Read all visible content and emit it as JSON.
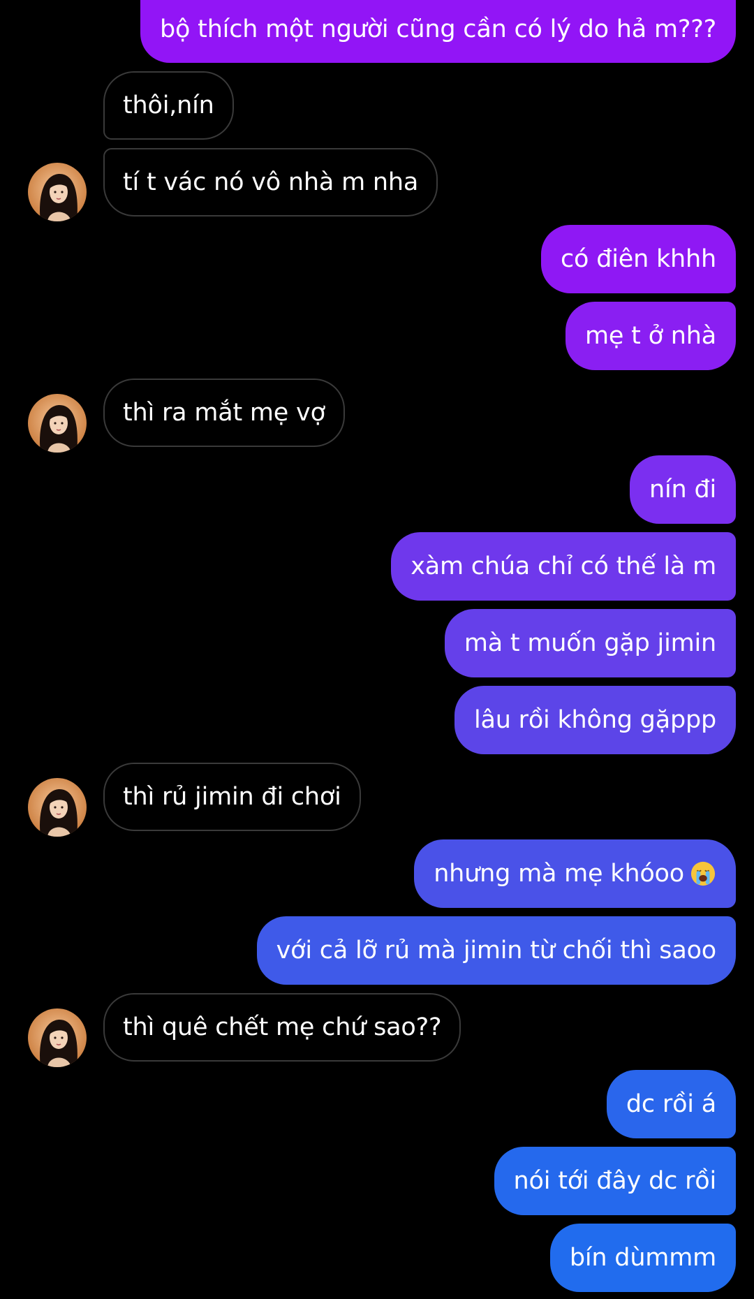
{
  "conversation": {
    "messages": [
      {
        "id": "m1",
        "direction": "out",
        "text": "bộ thích một người cũng cần có lý do hả m???",
        "color": "#9215f6"
      },
      {
        "id": "m2",
        "direction": "in",
        "text": "thôi,nín"
      },
      {
        "id": "m3",
        "direction": "in",
        "text": "tí t vác nó vô nhà m nha"
      },
      {
        "id": "m4",
        "direction": "out",
        "text": "có điên khhh",
        "color": "#8f18f4"
      },
      {
        "id": "m5",
        "direction": "out",
        "text": "mẹ t ở nhà",
        "color": "#8a1ff2"
      },
      {
        "id": "m6",
        "direction": "in",
        "text": "thì ra mắt mẹ vợ"
      },
      {
        "id": "m7",
        "direction": "out",
        "text": "nín đi",
        "color": "#7b2ff0"
      },
      {
        "id": "m8",
        "direction": "out",
        "text": "xàm chúa chỉ có thế là m",
        "color": "#6f38ec"
      },
      {
        "id": "m9",
        "direction": "out",
        "text": "mà t muốn gặp jimin",
        "color": "#6540ea"
      },
      {
        "id": "m10",
        "direction": "out",
        "text": "lâu rồi không gặppp",
        "color": "#5c45e8"
      },
      {
        "id": "m11",
        "direction": "in",
        "text": "thì rủ jimin đi chơi"
      },
      {
        "id": "m12",
        "direction": "out",
        "text": "nhưng mà mẹ khóoo",
        "color": "#4a52e8",
        "emoji": "loudly-crying-face-emoji"
      },
      {
        "id": "m13",
        "direction": "out",
        "text": "với cả lỡ rủ mà jimin từ chối thì saoo",
        "color": "#3f5ae9"
      },
      {
        "id": "m14",
        "direction": "in",
        "text": "thì quê chết mẹ chứ sao??"
      },
      {
        "id": "m15",
        "direction": "out",
        "text": "dc rồi á",
        "color": "#2a66ec"
      },
      {
        "id": "m16",
        "direction": "out",
        "text": "nói tới đây dc rồi",
        "color": "#2569ed"
      },
      {
        "id": "m17",
        "direction": "out",
        "text": "bín dùmmm",
        "color": "#216cee"
      }
    ]
  },
  "contact": {
    "avatar_icon": "contact-avatar"
  }
}
